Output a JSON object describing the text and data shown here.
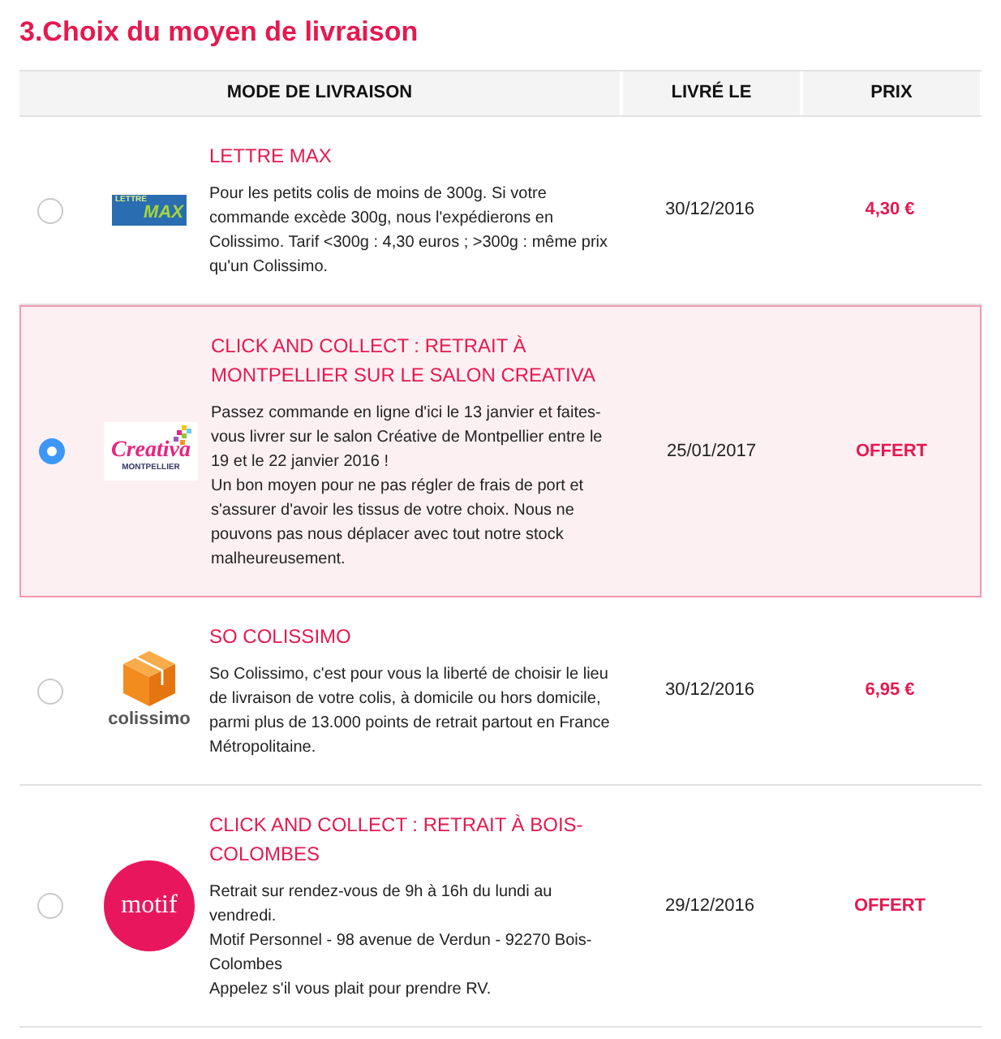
{
  "title": "3.Choix du moyen de livraison",
  "table": {
    "columns": [
      "MODE DE LIVRAISON",
      "LIVRÉ LE",
      "PRIX"
    ],
    "rows": [
      {
        "selected": false,
        "logo": {
          "kind": "lettre_max",
          "texts": [
            "LETTRE",
            "MAX"
          ]
        },
        "name": "LETTRE MAX",
        "description": [
          "Pour les petits colis de moins de 300g. Si votre commande excède 300g, nous l'expédierons en Colissimo. Tarif <300g : 4,30 euros ; >300g : même prix qu'un Colissimo."
        ],
        "date": "30/12/2016",
        "price": "4,30 €"
      },
      {
        "selected": true,
        "logo": {
          "kind": "creativa",
          "texts": [
            "Creativa",
            "MONTPELLIER"
          ]
        },
        "name": "CLICK AND COLLECT : RETRAIT À MONTPELLIER SUR LE SALON CREATIVA",
        "description": [
          "Passez commande en ligne d'ici le 13 janvier et faites-vous livrer sur le salon Créative de Montpellier entre le 19 et le 22 janvier 2016 !",
          "Un bon moyen pour ne pas régler de frais de port et s'assurer d'avoir les tissus de votre choix. Nous ne pouvons pas nous déplacer avec tout notre stock malheureusement."
        ],
        "date": "25/01/2017",
        "price": "OFFERT"
      },
      {
        "selected": false,
        "logo": {
          "kind": "colissimo",
          "texts": [
            "colissimo"
          ]
        },
        "name": "SO COLISSIMO",
        "description": [
          "So Colissimo, c'est pour vous la liberté de choisir le lieu de livraison de votre colis, à domicile ou hors domicile, parmi plus de 13.000 points de retrait partout en France Métropolitaine."
        ],
        "date": "30/12/2016",
        "price": "6,95 €"
      },
      {
        "selected": false,
        "logo": {
          "kind": "motif",
          "texts": [
            "motif"
          ]
        },
        "name": "CLICK AND COLLECT : RETRAIT À BOIS-COLOMBES",
        "description": [
          "Retrait sur rendez-vous de 9h à 16h du lundi au vendredi.",
          "Motif Personnel - 98 avenue de Verdun - 92270 Bois-Colombes",
          "Appelez s'il vous plait pour prendre RV."
        ],
        "date": "29/12/2016",
        "price": "OFFERT"
      }
    ]
  }
}
